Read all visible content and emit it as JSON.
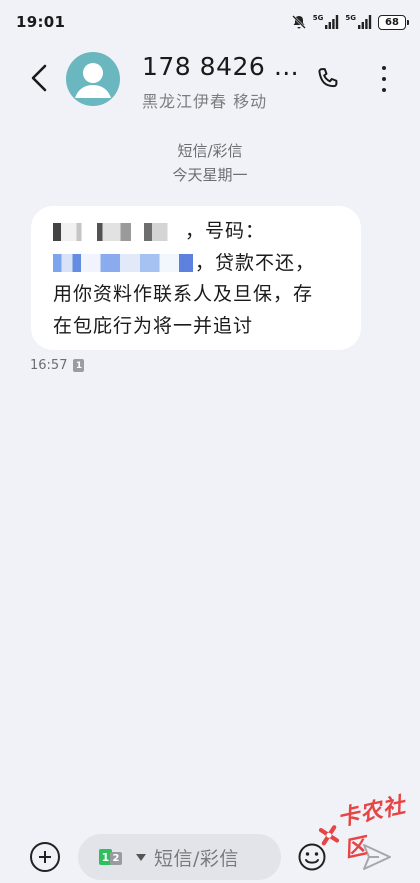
{
  "status_bar": {
    "time": "19:01",
    "sim1_network": "5G",
    "sim2_network": "5G",
    "battery": "68",
    "icons": [
      "mute-icon",
      "signal-icon",
      "signal-icon",
      "battery-icon"
    ]
  },
  "header": {
    "contact_name": "178 8426 …",
    "contact_location": "黑龙江伊春 移动",
    "icons": [
      "back-icon",
      "avatar-icon",
      "phone-icon",
      "more-vertical-icon"
    ]
  },
  "conversation": {
    "message_type": "短信/彩信",
    "date_label": "今天星期一",
    "messages": [
      {
        "lines": [
          "，号码：",
          "，贷款不还，",
          "用你资料作联系人及旦保，存",
          "在包庇行为将一并追讨"
        ],
        "time": "16:57",
        "sim": "1"
      }
    ]
  },
  "composer": {
    "sim_primary": "1",
    "sim_secondary": "2",
    "placeholder": "短信/彩信",
    "icons": [
      "add-icon",
      "sim-select-icon",
      "emoji-icon",
      "send-icon"
    ]
  },
  "watermark": {
    "text": "卡农社区",
    "color": "#e64545"
  },
  "colors": {
    "background": "#f1f2f7",
    "bubble": "#ffffff",
    "avatar": "#6bb7c0",
    "sim_green": "#2fbf5c"
  }
}
